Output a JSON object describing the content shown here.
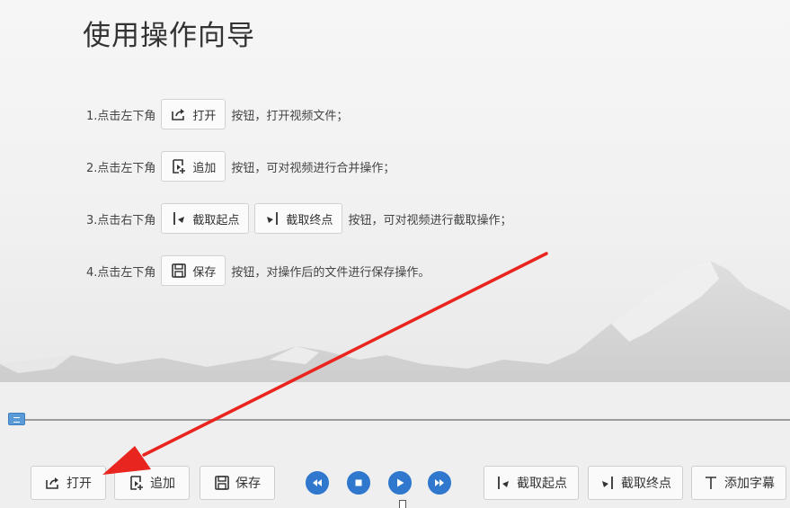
{
  "guide": {
    "title": "使用操作向导",
    "steps": [
      {
        "prefix": "1.点击左下角",
        "buttons": [
          "打开"
        ],
        "suffix": "按钮，打开视频文件；"
      },
      {
        "prefix": "2.点击左下角",
        "buttons": [
          "追加"
        ],
        "suffix": "按钮，可对视频进行合并操作；"
      },
      {
        "prefix": "3.点击右下角",
        "buttons": [
          "截取起点",
          "截取终点"
        ],
        "suffix": "按钮，可对视频进行截取操作；"
      },
      {
        "prefix": "4.点击左下角",
        "buttons": [
          "保存"
        ],
        "suffix": "按钮，对操作后的文件进行保存操作。"
      }
    ]
  },
  "toolbar": {
    "open_label": "打开",
    "append_label": "追加",
    "save_label": "保存",
    "cut_start_label": "截取起点",
    "cut_end_label": "截取终点",
    "subtitle_label": "添加字幕"
  },
  "progress": {
    "position_fraction": 0.0
  },
  "colors": {
    "media_blue": "#2f78ce",
    "annotation_arrow": "#e8261f",
    "progress_handle": "#5a9ad6"
  },
  "icons": {
    "open": "share-out-icon",
    "append": "add-file-icon",
    "save": "floppy-disk-icon",
    "cut_start": "cut-start-icon",
    "cut_end": "cut-end-icon",
    "subtitle": "text-t-icon",
    "rewind": "rewind-icon",
    "stop": "stop-icon",
    "play": "play-icon",
    "forward": "fast-forward-icon"
  }
}
